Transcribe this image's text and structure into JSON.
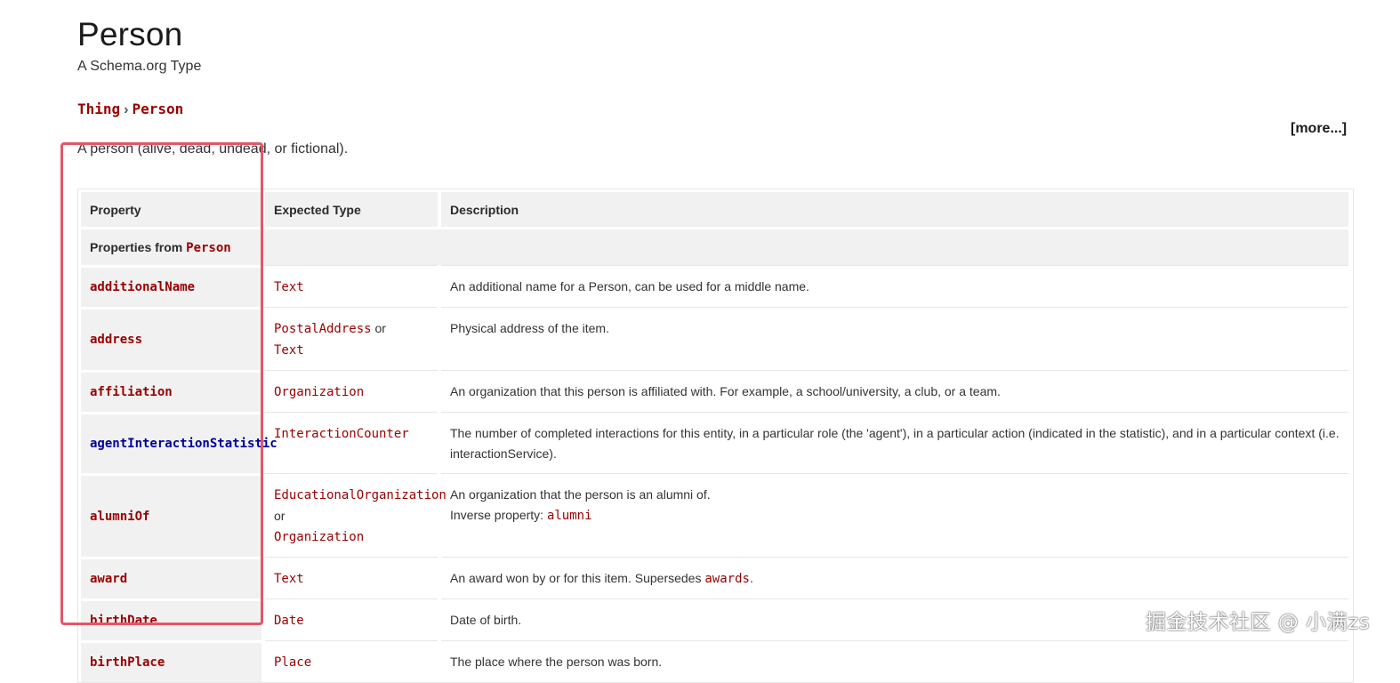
{
  "page": {
    "title": "Person",
    "subtitle": "A Schema.org Type",
    "description": "A person (alive, dead, undead, or fictional).",
    "more_label": "[more...]"
  },
  "breadcrumb": {
    "items": [
      "Thing",
      "Person"
    ],
    "separator": "›"
  },
  "table": {
    "headers": [
      "Property",
      "Expected Type",
      "Description"
    ],
    "section": {
      "prefix": "Properties from ",
      "type": "Person"
    },
    "rows": [
      {
        "name": "additionalName",
        "types": [
          "Text"
        ],
        "or_label": "",
        "description": "An additional name for a Person, can be used for a middle name."
      },
      {
        "name": "address",
        "types": [
          "PostalAddress",
          "Text"
        ],
        "or_label": "or",
        "description": "Physical address of the item."
      },
      {
        "name": "affiliation",
        "types": [
          "Organization"
        ],
        "or_label": "",
        "description": "An organization that this person is affiliated with. For example, a school/university, a club, or a team."
      },
      {
        "name": "agentInteractionStatistic",
        "types": [
          "InteractionCounter"
        ],
        "or_label": "",
        "description": "The number of completed interactions for this entity, in a particular role (the 'agent'), in a particular action (indicated in the statistic), and in a particular context (i.e. interactionService)."
      },
      {
        "name": "alumniOf",
        "types": [
          "EducationalOrganization",
          "Organization"
        ],
        "or_label": "or",
        "description": "An organization that the person is an alumni of.",
        "inverse_label": "Inverse property: ",
        "inverse_value": "alumni"
      },
      {
        "name": "award",
        "types": [
          "Text"
        ],
        "or_label": "",
        "description": "An award won by or for this item. Supersedes ",
        "supersedes": "awards",
        "suffix": "."
      },
      {
        "name": "birthDate",
        "types": [
          "Date"
        ],
        "or_label": "",
        "description": "Date of birth."
      },
      {
        "name": "birthPlace",
        "types": [
          "Place"
        ],
        "or_label": "",
        "description": "The place where the person was born."
      }
    ]
  },
  "watermark": "掘金技术社区 @ 小满zs",
  "colors": {
    "link": "#990000",
    "pending": "#000099",
    "highlight": "#e2576a",
    "header_bg": "#f1f1f1"
  }
}
